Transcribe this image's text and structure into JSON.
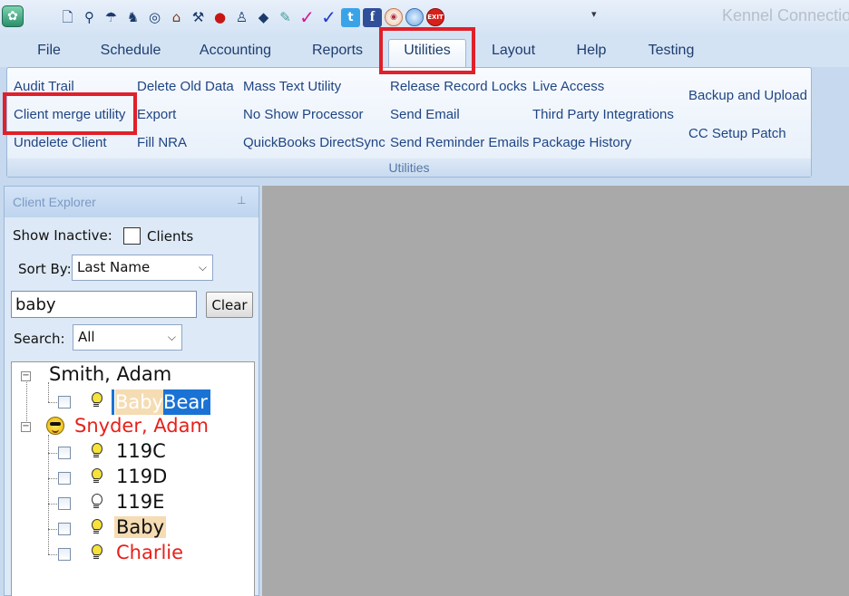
{
  "app": {
    "title": "Kennel Connection"
  },
  "quick_access": {
    "icons": [
      "new-document-icon",
      "binoculars-icon",
      "hat-icon",
      "figure-icon",
      "cd-icon",
      "house-icon",
      "tools-icon",
      "apple-icon",
      "walking-person-icon",
      "graduation-cap-icon",
      "pen-icon",
      "pink-check-icon",
      "blue-check-icon",
      "twitter-icon",
      "facebook-icon",
      "globe-icon",
      "circle-icon",
      "exit-icon"
    ],
    "exit_label": "EXIT",
    "facebook_glyph": "f",
    "twitter_glyph": "t",
    "dropdown_glyph": "▾"
  },
  "ribbon": {
    "tabs": [
      {
        "label": "File"
      },
      {
        "label": "Schedule"
      },
      {
        "label": "Accounting"
      },
      {
        "label": "Reports"
      },
      {
        "label": "Utilities"
      },
      {
        "label": "Layout"
      },
      {
        "label": "Help"
      },
      {
        "label": "Testing"
      }
    ],
    "active_tab": "Utilities",
    "group_label": "Utilities",
    "commands": {
      "audit_trail": "Audit Trail",
      "client_merge": "Client merge utility",
      "undelete_client": "Undelete Client",
      "delete_old_data": "Delete Old Data",
      "export": "Export",
      "fill_nra": "Fill NRA",
      "mass_text": "Mass Text Utility",
      "no_show": "No Show Processor",
      "quickbooks": "QuickBooks DirectSync",
      "release_locks": "Release Record Locks",
      "send_email": "Send Email",
      "send_reminder": "Send Reminder Emails",
      "live_access": "Live Access",
      "third_party": "Third Party Integrations",
      "package_history": "Package History",
      "backup_upload": "Backup and Upload",
      "cc_setup": "CC Setup Patch"
    }
  },
  "explorer": {
    "title": "Client Explorer",
    "pin_glyph": "⊥",
    "show_inactive_label": "Show Inactive:",
    "clients_checkbox_label": "Clients",
    "sort_by_label": "Sort By:",
    "sort_by_value": "Last Name",
    "search_value": "baby",
    "clear_label": "Clear",
    "search_label": "Search:",
    "search_scope_value": "All",
    "tree": {
      "clients": [
        {
          "name": "Smith, Adam",
          "color": "#111111",
          "pets": [
            {
              "name_match": "Baby",
              "name_rest": " Bear",
              "selected": true
            }
          ]
        },
        {
          "name": "Snyder, Adam",
          "color": "#e8201a",
          "pets": [
            {
              "name": "119C",
              "color": "#111111"
            },
            {
              "name": "119D",
              "color": "#111111"
            },
            {
              "name": "119E",
              "color": "#111111"
            },
            {
              "name": "Baby",
              "color": "#111111",
              "highlight": true
            },
            {
              "name": "Charlie",
              "color": "#e8201a"
            }
          ]
        }
      ]
    }
  },
  "colors": {
    "highlight_red": "#e0202a",
    "search_highlight": "#f5dcb3",
    "selection_blue": "#1a73d4"
  }
}
